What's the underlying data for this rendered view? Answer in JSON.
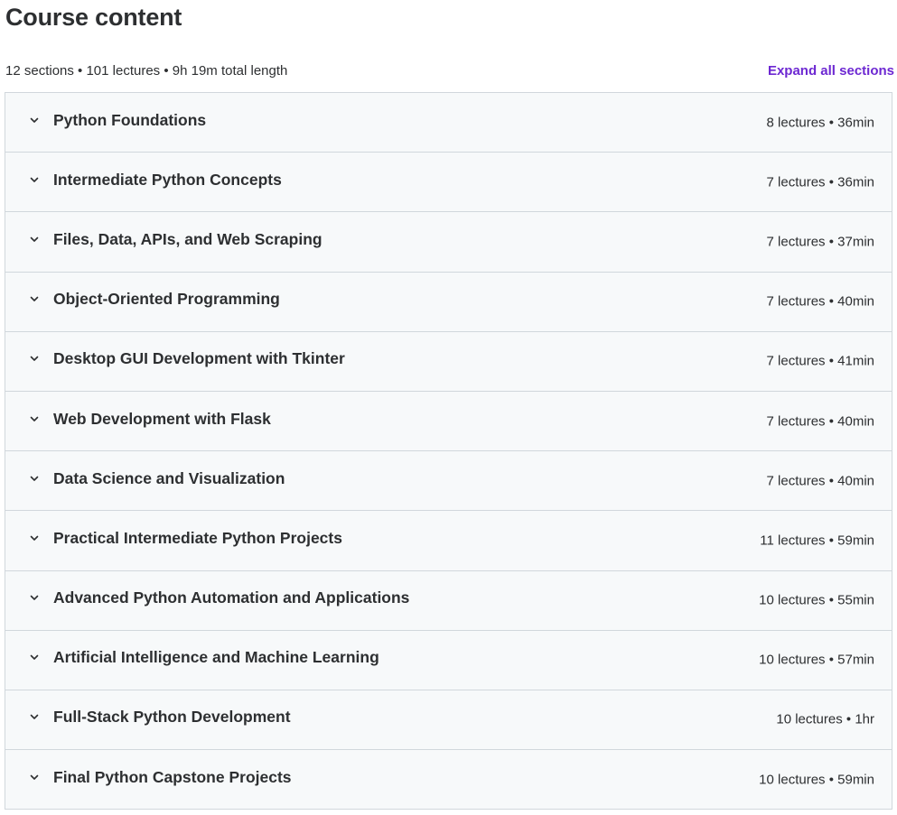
{
  "header": {
    "title": "Course content"
  },
  "summary": {
    "text": "12 sections • 101 lectures • 9h 19m total length",
    "expand_all_label": "Expand all sections"
  },
  "colors": {
    "accent": "#6d28d2",
    "section_bg": "#f7f9fa",
    "border": "#d1d7dc",
    "text": "#2d2f31"
  },
  "icons": {
    "section_toggle": "chevron-down-icon"
  },
  "sections": [
    {
      "title": "Python Foundations",
      "meta": "8 lectures • 36min"
    },
    {
      "title": "Intermediate Python Concepts",
      "meta": "7 lectures • 36min"
    },
    {
      "title": "Files, Data, APIs, and Web Scraping",
      "meta": "7 lectures • 37min"
    },
    {
      "title": "Object-Oriented Programming",
      "meta": "7 lectures • 40min"
    },
    {
      "title": "Desktop GUI Development with Tkinter",
      "meta": "7 lectures • 41min"
    },
    {
      "title": "Web Development with Flask",
      "meta": "7 lectures • 40min"
    },
    {
      "title": "Data Science and Visualization",
      "meta": "7 lectures • 40min"
    },
    {
      "title": "Practical Intermediate Python Projects",
      "meta": "11 lectures • 59min"
    },
    {
      "title": "Advanced Python Automation and Applications",
      "meta": "10 lectures • 55min"
    },
    {
      "title": "Artificial Intelligence and Machine Learning",
      "meta": "10 lectures • 57min"
    },
    {
      "title": "Full-Stack Python Development",
      "meta": "10 lectures • 1hr"
    },
    {
      "title": "Final Python Capstone Projects",
      "meta": "10 lectures • 59min"
    }
  ]
}
